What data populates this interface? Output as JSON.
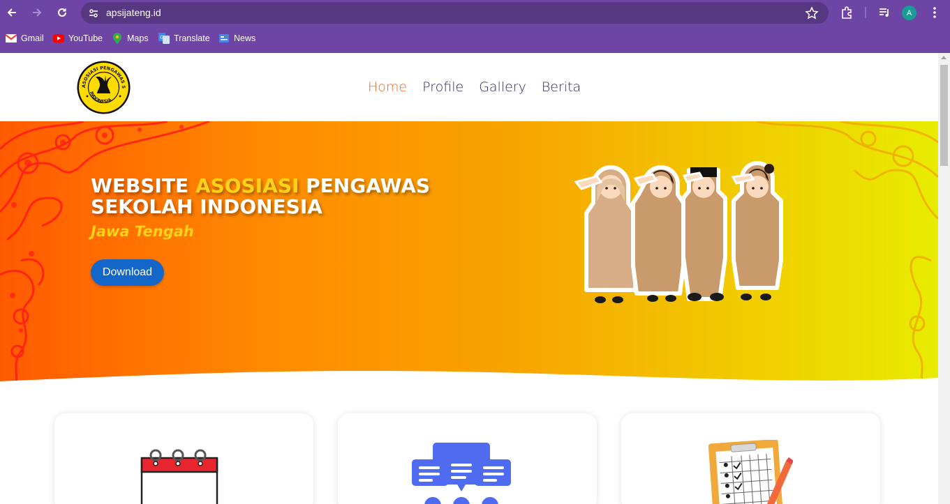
{
  "browser": {
    "url": "apsijateng.id",
    "profile_initial": "A",
    "bookmarks": [
      {
        "label": "Gmail",
        "icon": "gmail-icon"
      },
      {
        "label": "YouTube",
        "icon": "youtube-icon"
      },
      {
        "label": "Maps",
        "icon": "maps-icon"
      },
      {
        "label": "Translate",
        "icon": "translate-icon"
      },
      {
        "label": "News",
        "icon": "news-icon"
      }
    ]
  },
  "site": {
    "menu": [
      {
        "label": "Home",
        "active": true
      },
      {
        "label": "Profile",
        "active": false
      },
      {
        "label": "Gallery",
        "active": false
      },
      {
        "label": "Berita",
        "active": false
      }
    ],
    "logo_text": "ASOSIASI PENGAWAS SEKOLAH INDONESIA"
  },
  "hero": {
    "title_part1": "WEBSITE ",
    "title_accent": "ASOSIASI",
    "title_part2": " PENGAWAS",
    "title_line2": "SEKOLAH INDONESIA",
    "subtitle": "Jawa Tengah",
    "download_label": "Download"
  },
  "colors": {
    "chrome": "#6e45a5",
    "omnibox": "#573782",
    "menu_active": "#e86a2e",
    "menu_text": "#2d2a55",
    "button": "#1466c8",
    "accent_yellow": "#ffd21a"
  },
  "cards": [
    {
      "icon": "calendar-icon"
    },
    {
      "icon": "chat-bubbles-icon"
    },
    {
      "icon": "checklist-clipboard-icon"
    }
  ]
}
